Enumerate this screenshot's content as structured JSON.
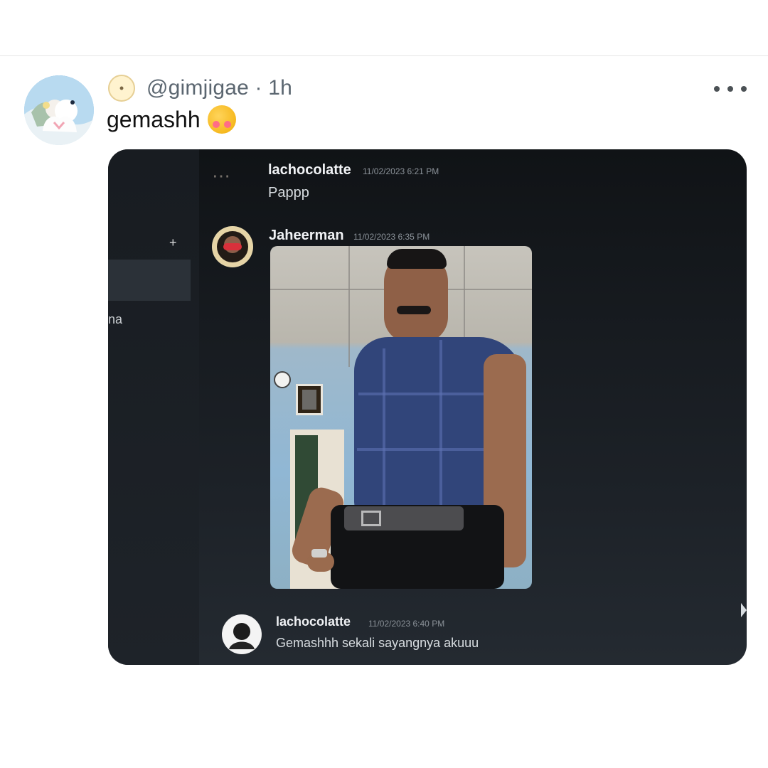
{
  "post": {
    "handle": "@gimjigae",
    "time": "1h",
    "text": "gemashh"
  },
  "screenshot": {
    "sidebar_fragment": "na",
    "messages": [
      {
        "username": "lachocolatte",
        "timestamp": "11/02/2023 6:21 PM",
        "text": "Pappp"
      },
      {
        "username": "Jaheerman",
        "timestamp": "11/02/2023 6:35 PM"
      },
      {
        "username": "lachocolatte",
        "timestamp": "11/02/2023 6:40 PM",
        "text": "Gemashhh sekali sayangnya akuuu"
      }
    ]
  },
  "icons": {
    "more": "more-options-icon",
    "face": "smiling-face-with-hearts-icon",
    "avatar": "profile-avatar-icon"
  }
}
